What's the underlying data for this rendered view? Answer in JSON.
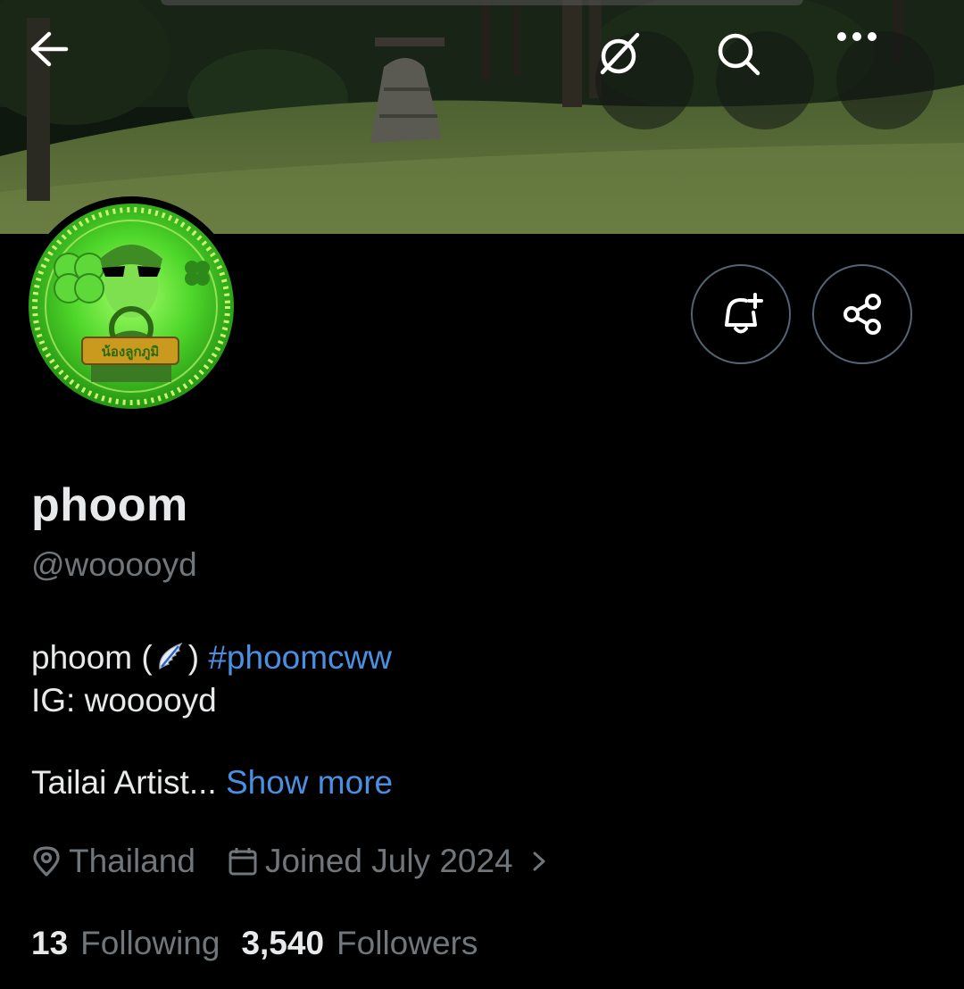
{
  "profile": {
    "display_name": "phoom",
    "handle": "@wooooyd",
    "bio": {
      "line1_prefix": "phoom (",
      "line1_suffix": ")",
      "hashtag": "#phoomcww",
      "line2": "IG: wooooyd",
      "line3": "Tailai Artist...",
      "show_more": "Show more"
    },
    "location": "Thailand",
    "joined": "Joined July 2024",
    "following_count": "13",
    "following_label": "Following",
    "followers_count": "3,540",
    "followers_label": "Followers",
    "avatar_badge_text": "น้องลูกภูมิ"
  },
  "icons": {
    "back": "back-arrow-icon",
    "grok": "grok-icon",
    "search": "search-icon",
    "more": "more-horizontal-icon",
    "bell": "notification-bell-add-icon",
    "share": "share-icon",
    "location": "location-pin-icon",
    "calendar": "calendar-icon",
    "chevron": "chevron-right-icon",
    "wing": "wing-emoji-icon"
  },
  "colors": {
    "background": "#000000",
    "primary_text": "#e7e9ea",
    "secondary_text": "#71767b",
    "link": "#4a90e2",
    "border": "#536471"
  }
}
